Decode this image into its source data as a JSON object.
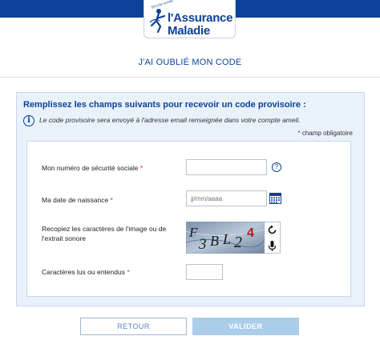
{
  "header": {
    "brand_line1": "l'Assurance",
    "brand_line2": "Maladie",
    "brand_tagline": "Sécurité sociale",
    "brand_color": "#0c419a"
  },
  "page": {
    "title": "J'AI OUBLIÉ MON CODE"
  },
  "panel": {
    "heading": "Remplissez les champs suivants pour recevoir un code provisoire :",
    "info_icon": "info-icon",
    "info_text": "Le code provisoire sera envoyé à l'adresse email renseignée dans votre compte ameli.",
    "required_star": "*",
    "required_note": " champ obligatoire"
  },
  "form": {
    "ssn": {
      "label": "Mon numéro de sécurité sociale",
      "required": "*",
      "value": "",
      "help_icon": "question-circle-icon"
    },
    "birthdate": {
      "label": "Ma date de naissance",
      "required": "*",
      "placeholder": "jj/mm/aaaa",
      "calendar_icon": "calendar-icon"
    },
    "captcha": {
      "label_line1": "Recopiez les caractères de l'image ou de",
      "label_line2": "l'extrait sonore",
      "image_text": "F3BL24",
      "refresh_icon": "refresh-icon",
      "audio_icon": "microphone-icon"
    },
    "captcha_answer": {
      "label": "Caractères lus ou entendus",
      "required": "*",
      "value": ""
    }
  },
  "actions": {
    "back_label": "RETOUR",
    "submit_label": "VALIDER"
  },
  "colors": {
    "accent": "#0c419a",
    "required": "#cc2f67",
    "panel_bg": "#e9f1fb",
    "submit_disabled": "#aacdea"
  }
}
